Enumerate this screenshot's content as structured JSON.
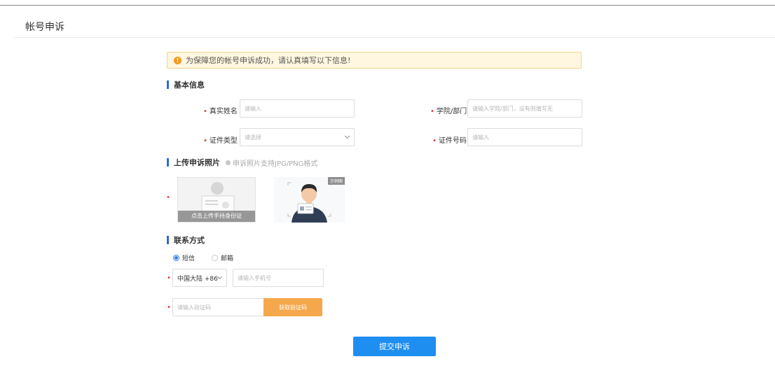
{
  "page": {
    "title": "帐号申诉"
  },
  "notice": {
    "icon": "info-icon",
    "text": "为保障您的帐号申诉成功，请认真填写以下信息!"
  },
  "basic": {
    "heading": "基本信息",
    "real_name": {
      "label": "真实姓名",
      "placeholder": "请输入"
    },
    "department": {
      "label": "学院/部门",
      "placeholder": "请输入学院/部门，没有则填写无"
    },
    "id_type": {
      "label": "证件类型",
      "placeholder": "请选择"
    },
    "id_number": {
      "label": "证件号码",
      "placeholder": "请输入"
    }
  },
  "photo": {
    "heading": "上传申诉照片",
    "hint": "申诉照片支持JPG/PNG格式",
    "upload_caption": "点击上传手持身份证",
    "example_tag": "示例图"
  },
  "contact": {
    "heading": "联系方式",
    "methods": [
      {
        "label": "短信",
        "selected": true
      },
      {
        "label": "邮箱",
        "selected": false
      }
    ],
    "region": "中国大陆 +86",
    "phone_placeholder": "请输入手机号",
    "code_placeholder": "请输入验证码",
    "get_code_label": "获取验证码"
  },
  "submit_label": "提交申诉",
  "colors": {
    "accent": "#1f8ef1",
    "section_bar": "#2e6bd6",
    "code_button": "#f5a84b",
    "required": "#e5322d",
    "notice_bg": "#fff7e0"
  }
}
